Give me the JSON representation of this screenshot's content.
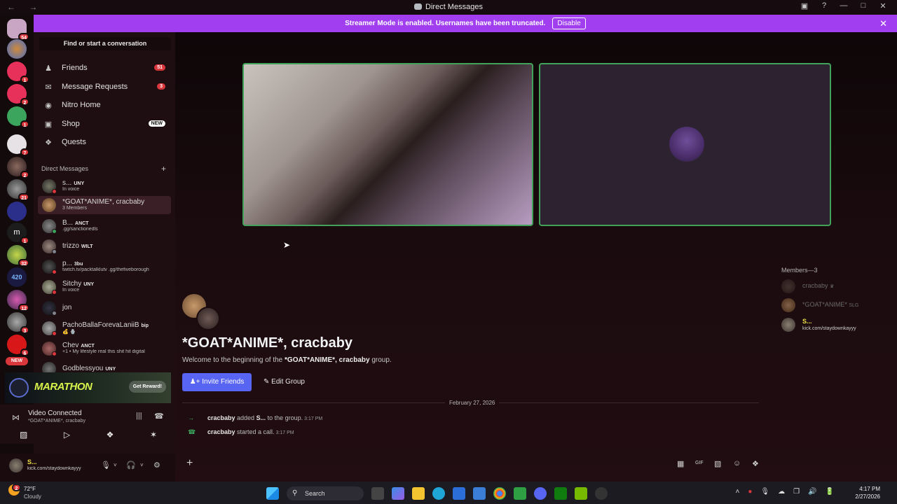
{
  "window": {
    "title": "Direct Messages",
    "nav_icons": "← →",
    "controls": [
      "▣",
      "?",
      "—",
      "□",
      "✕"
    ]
  },
  "banner": {
    "text": "Streamer Mode is enabled. Usernames have been truncated.",
    "disable_label": "Disable",
    "close": "✕"
  },
  "guilds": {
    "badges": [
      "54",
      "1",
      "2",
      "1",
      "7",
      "2",
      "21",
      "1",
      "32",
      "12",
      "3",
      "6"
    ],
    "new_label": "NEW",
    "m_label": "m",
    "num_label": "420"
  },
  "sidebar": {
    "search_label": "Find or start a conversation",
    "nav": [
      {
        "label": "Friends",
        "icon": "friends-icon",
        "badge": "51"
      },
      {
        "label": "Message Requests",
        "icon": "mail-icon",
        "badge": "3"
      },
      {
        "label": "Nitro Home",
        "icon": "nitro-icon"
      },
      {
        "label": "Shop",
        "icon": "shop-icon",
        "badge_new": "NEW"
      },
      {
        "label": "Quests",
        "icon": "quests-icon"
      }
    ],
    "dm_header": "Direct Messages",
    "dm_header_plus": "+",
    "dms": [
      {
        "name": "s...",
        "tag": "UNY",
        "sub": "In voice"
      },
      {
        "name": "*GOAT*ANIME*, cracbaby",
        "sub": "3 Members"
      },
      {
        "name": "B...",
        "tag": "ANCT",
        "sub": ".gg/sanctionedls"
      },
      {
        "name": "trizzo",
        "tag": "WILT"
      },
      {
        "name": "p...",
        "tag": "3bu",
        "sub": "twitch.tv/packtalklutv .gg/thefiveborough"
      },
      {
        "name": "Sitchy",
        "tag": "UNY",
        "sub": "In voice"
      },
      {
        "name": "jon"
      },
      {
        "name": "PachoBallaForevaLaniiB",
        "tag": "bip",
        "sub": "💰 🪬"
      },
      {
        "name": "Chev",
        "tag": "ANCT",
        "sub": "+1 • My lifestyle real this shit hit digital"
      },
      {
        "name": "Godblessyou",
        "tag": "UNY"
      }
    ]
  },
  "ad": {
    "title": "MARATHON",
    "button": "Get Reward!"
  },
  "voice": {
    "status": "Video Connected",
    "channel": "*GOAT*ANIME*, cracbaby",
    "signal_icon": "⋈",
    "wave_icon": "|||",
    "hangup_icon": "☎",
    "buttons": [
      "▨",
      "▷",
      "❖",
      "✶"
    ]
  },
  "user": {
    "name": "S...",
    "status": "kick.com/staydownkayyy",
    "icons": [
      "🎙",
      "˅",
      "🎧",
      "˅",
      "⚙"
    ]
  },
  "main": {
    "group_title": "*GOAT*ANIME*, cracbaby",
    "welcome_prefix": "Welcome to the beginning of the ",
    "welcome_group": "*GOAT*ANIME*, cracbaby",
    "welcome_suffix": " group.",
    "invite_label": "Invite Friends",
    "edit_label": "Edit Group",
    "date_divider": "February 27, 2026",
    "messages": [
      {
        "arrow": "→",
        "who": "cracbaby",
        "text1": " added ",
        "target": "S...",
        "text2": " to the group.",
        "time": "3:17 PM"
      },
      {
        "arrow": "☎",
        "who": "cracbaby",
        "text1": " started a call.",
        "time": "3:17 PM"
      }
    ],
    "composer_plus": "+",
    "composer_icons": [
      "▦",
      "GIF",
      "▧",
      "☺",
      "❖"
    ]
  },
  "members": {
    "header": "Members—3",
    "list": [
      {
        "name": "cracbaby",
        "extra": "♛"
      },
      {
        "name": "*GOAT*ANIME*",
        "extra": "SLG"
      },
      {
        "name": "S...",
        "sub": "kick.com/staydownkayyy"
      }
    ]
  },
  "taskbar": {
    "temp": "72°F",
    "weather": "Cloudy",
    "weather_badge": "2",
    "search": "Search",
    "time": "4:17 PM",
    "date": "2/27/2026",
    "tray_icons": [
      "˄",
      "●",
      "🎙",
      "☁",
      "❐",
      "🔊",
      "🔋"
    ]
  },
  "colors": {
    "banner": "#a13ff0",
    "invite_button": "#5865f2",
    "speaking_border": "#43a25a",
    "badge": "#da373c"
  }
}
